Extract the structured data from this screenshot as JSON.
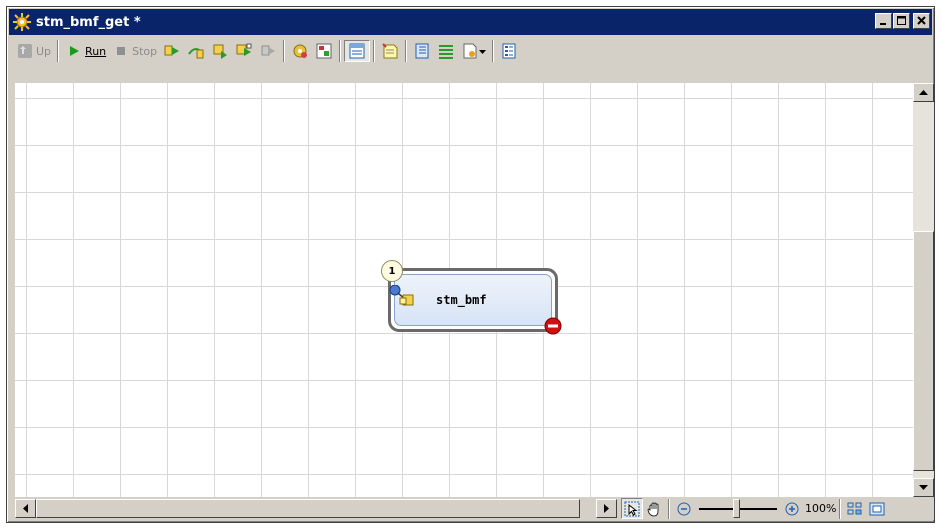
{
  "window": {
    "title": "stm_bmf_get *"
  },
  "toolbar": {
    "up_label": "Up",
    "run_label": "Run",
    "stop_label": "Stop"
  },
  "canvas": {
    "node": {
      "label": "stm_bmf",
      "badge": "1"
    }
  },
  "statusbar": {
    "zoom": "100%"
  },
  "colors": {
    "titlebar": "#0a246a",
    "chrome": "#d4d0c8",
    "run_green": "#1a9a1a",
    "stop_red": "#d01010"
  }
}
